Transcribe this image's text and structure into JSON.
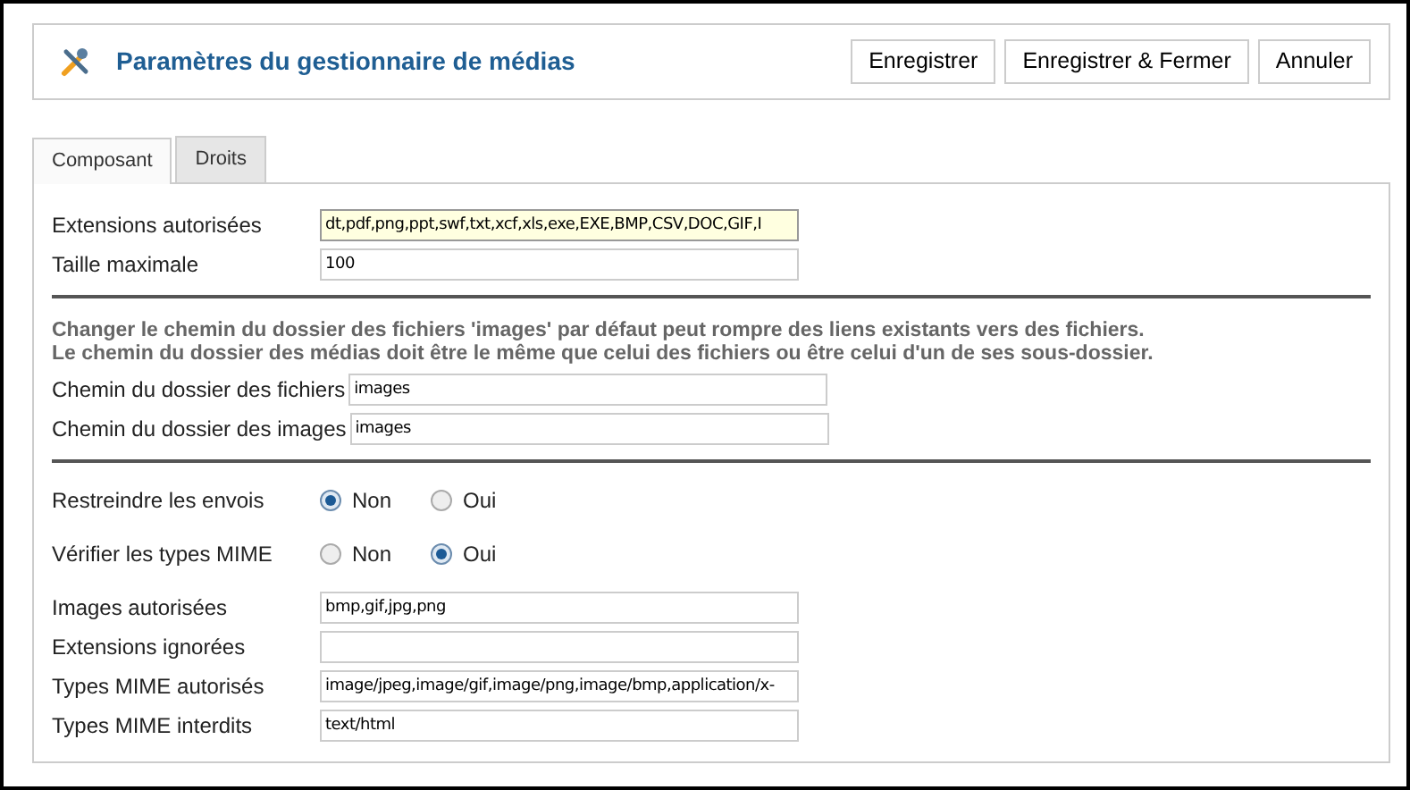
{
  "header": {
    "title": "Paramètres du gestionnaire de médias",
    "buttons": [
      "Enregistrer",
      "Enregistrer & Fermer",
      "Annuler"
    ]
  },
  "tabs": [
    {
      "label": "Composant",
      "selected": true
    },
    {
      "label": "Droits",
      "selected": false
    }
  ],
  "sections": [
    {
      "kind": "aligned",
      "fields": [
        {
          "kind": "text",
          "label": "Extensions autorisées",
          "value": "dt,pdf,png,ppt,swf,txt,xcf,xls,exe,EXE,BMP,CSV,DOC,GIF,I",
          "focused": true
        },
        {
          "kind": "text",
          "label": "Taille maximale",
          "value": "100",
          "focused": false
        }
      ]
    },
    {
      "kind": "inline",
      "note": [
        "Changer le chemin du dossier des fichiers 'images' par défaut peut rompre des liens existants vers des fichiers.",
        "Le chemin du dossier des médias doit être le même que celui des fichiers ou être celui d'un de ses sous-dossier."
      ],
      "fields": [
        {
          "kind": "text",
          "label": "Chemin du dossier des fichiers",
          "value": "images",
          "focused": false
        },
        {
          "kind": "text",
          "label": "Chemin du dossier des images",
          "value": "images",
          "focused": false
        }
      ]
    },
    {
      "kind": "aligned",
      "fields": [
        {
          "kind": "radio",
          "label": "Restreindre les envois",
          "options": [
            {
              "label": "Non",
              "selected": true
            },
            {
              "label": "Oui",
              "selected": false
            }
          ]
        },
        {
          "kind": "radio",
          "label": "Vérifier les types MIME",
          "options": [
            {
              "label": "Non",
              "selected": false
            },
            {
              "label": "Oui",
              "selected": true
            }
          ]
        },
        {
          "kind": "text",
          "label": "Images autorisées",
          "value": "bmp,gif,jpg,png",
          "focused": false
        },
        {
          "kind": "text",
          "label": "Extensions ignorées",
          "focused": false
        },
        {
          "kind": "text",
          "label": "Types MIME autorisés",
          "value": "image/jpeg,image/gif,image/png,image/bmp,application/x-",
          "focused": false
        },
        {
          "kind": "text",
          "label": "Types MIME interdits",
          "value": "text/html",
          "focused": false
        }
      ]
    }
  ]
}
